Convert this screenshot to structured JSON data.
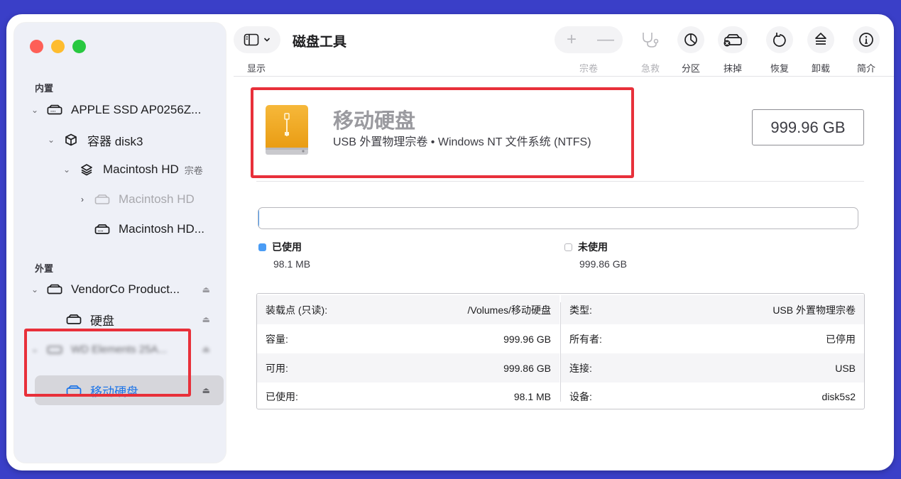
{
  "toolbar": {
    "view_label": "显示",
    "app_title": "磁盘工具",
    "buttons": [
      {
        "label": "宗卷",
        "enabled": false,
        "icon": "plus-minus-icon"
      },
      {
        "label": "急救",
        "enabled": false,
        "icon": "stethoscope-icon"
      },
      {
        "label": "分区",
        "enabled": true,
        "icon": "pie-chart-icon"
      },
      {
        "label": "抹掉",
        "enabled": true,
        "icon": "erase-drive-icon"
      },
      {
        "label": "恢复",
        "enabled": true,
        "icon": "restore-icon"
      },
      {
        "label": "卸载",
        "enabled": true,
        "icon": "unmount-icon"
      },
      {
        "label": "简介",
        "enabled": true,
        "icon": "info-icon"
      }
    ]
  },
  "sidebar": {
    "internal_header": "内置",
    "external_header": "外置",
    "items": [
      {
        "label": "APPLE SSD AP0256Z..."
      },
      {
        "label": "容器 disk3"
      },
      {
        "label": "Macintosh HD",
        "sub": "宗卷"
      },
      {
        "label": "Macintosh HD"
      },
      {
        "label": "Macintosh HD..."
      },
      {
        "label": "VendorCo Product..."
      },
      {
        "label": "硬盘"
      },
      {
        "label": "WD Elements 25A..."
      },
      {
        "label": "移动硬盘"
      }
    ]
  },
  "volume": {
    "name": "移动硬盘",
    "description": "USB 外置物理宗卷 • Windows NT 文件系统 (NTFS)",
    "capacity": "999.96 GB"
  },
  "usage": {
    "used_label": "已使用",
    "used_value": "98.1 MB",
    "free_label": "未使用",
    "free_value": "999.86 GB",
    "used_fraction": 0.0001,
    "used_color": "#4a9cf5"
  },
  "info": {
    "left": [
      {
        "key": "装载点 (只读):",
        "value": "/Volumes/移动硬盘"
      },
      {
        "key": "容量:",
        "value": "999.96 GB"
      },
      {
        "key": "可用:",
        "value": "999.86 GB"
      },
      {
        "key": "已使用:",
        "value": "98.1 MB"
      }
    ],
    "right": [
      {
        "key": "类型:",
        "value": "USB 外置物理宗卷"
      },
      {
        "key": "所有者:",
        "value": "已停用"
      },
      {
        "key": "连接:",
        "value": "USB"
      },
      {
        "key": "设备:",
        "value": "disk5s2"
      }
    ]
  },
  "colors": {
    "highlight": "#e8303a",
    "accent": "#1a73e8",
    "background": "#3a3fc8"
  }
}
